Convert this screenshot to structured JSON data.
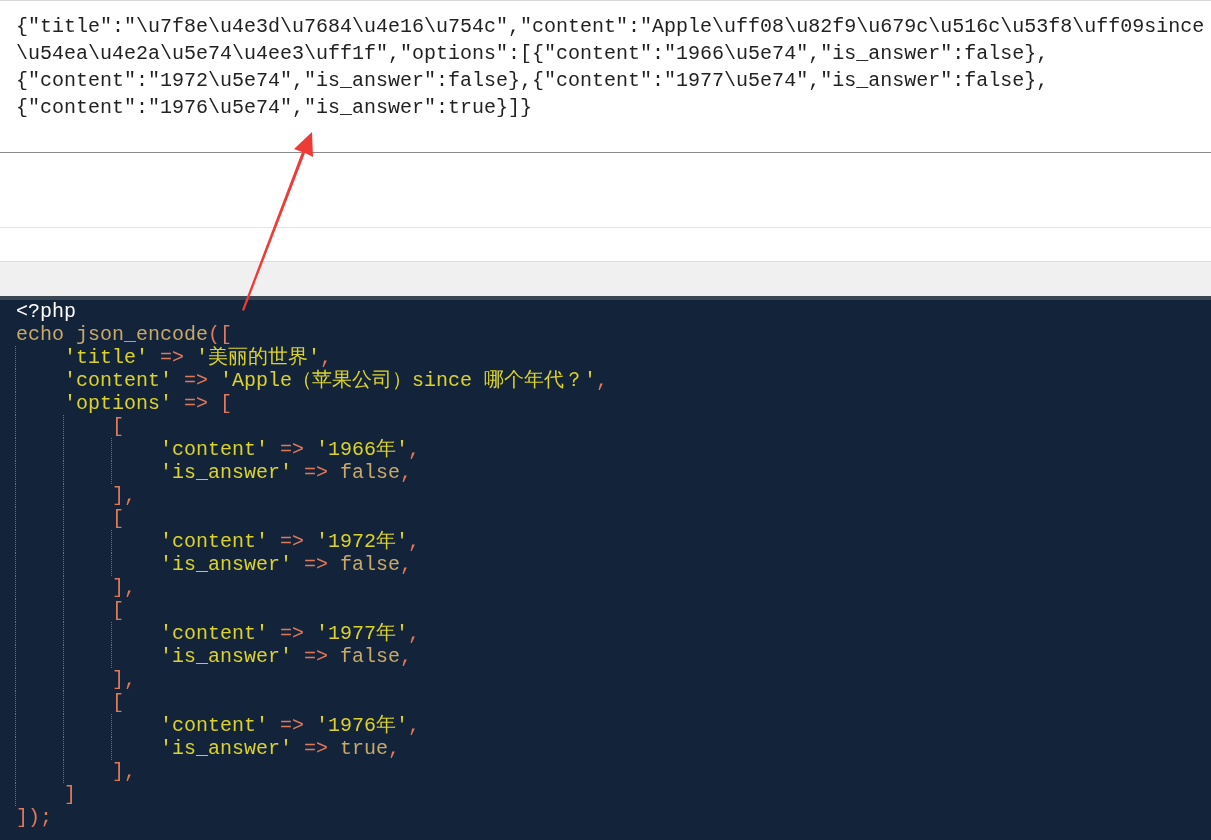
{
  "output_panel": {
    "lines": [
      "{\"title\":\"\\u7f8e\\u4e3d\\u7684\\u4e16\\u754c\",\"content\":\"Apple\\uff08\\u82f9\\u679c\\u516c\\u53f8\\uff09since",
      "\\u54ea\\u4e2a\\u5e74\\u4ee3\\uff1f\",\"options\":[{\"content\":\"1966\\u5e74\",\"is_answer\":false},",
      "{\"content\":\"1972\\u5e74\",\"is_answer\":false},{\"content\":\"1977\\u5e74\",\"is_answer\":false},",
      "{\"content\":\"1976\\u5e74\",\"is_answer\":true}]}"
    ]
  },
  "code_editor": {
    "lines": [
      {
        "tokens": [
          {
            "text": "<?php",
            "kind": "tag"
          }
        ]
      },
      {
        "tokens": [
          {
            "text": "echo json_encode",
            "kind": "keyword"
          },
          {
            "text": "([",
            "kind": "punct"
          }
        ],
        "children": [
          {
            "tokens": [
              {
                "text": "'title'",
                "kind": "string"
              },
              {
                "text": " => ",
                "kind": "punct"
              },
              {
                "text": "'美丽的世界'",
                "kind": "string"
              },
              {
                "text": ",",
                "kind": "punct"
              }
            ]
          },
          {
            "tokens": [
              {
                "text": "'content'",
                "kind": "string"
              },
              {
                "text": " => ",
                "kind": "punct"
              },
              {
                "text": "'Apple（苹果公司）since 哪个年代？'",
                "kind": "string"
              },
              {
                "text": ",",
                "kind": "punct"
              }
            ]
          },
          {
            "tokens": [
              {
                "text": "'options'",
                "kind": "string"
              },
              {
                "text": " => [",
                "kind": "punct"
              }
            ],
            "children": [
              {
                "tokens": [
                  {
                    "text": "[",
                    "kind": "punct"
                  }
                ],
                "children": [
                  {
                    "tokens": [
                      {
                        "text": "'content'",
                        "kind": "string"
                      },
                      {
                        "text": " => ",
                        "kind": "punct"
                      },
                      {
                        "text": "'1966年'",
                        "kind": "string"
                      },
                      {
                        "text": ",",
                        "kind": "punct"
                      }
                    ]
                  },
                  {
                    "tokens": [
                      {
                        "text": "'is_answer'",
                        "kind": "string"
                      },
                      {
                        "text": " => ",
                        "kind": "punct"
                      },
                      {
                        "text": "false",
                        "kind": "keyword"
                      },
                      {
                        "text": ",",
                        "kind": "punct"
                      }
                    ]
                  }
                ]
              },
              {
                "tokens": [
                  {
                    "text": "],",
                    "kind": "punct"
                  }
                ]
              },
              {
                "tokens": [
                  {
                    "text": "[",
                    "kind": "punct"
                  }
                ],
                "children": [
                  {
                    "tokens": [
                      {
                        "text": "'content'",
                        "kind": "string"
                      },
                      {
                        "text": " => ",
                        "kind": "punct"
                      },
                      {
                        "text": "'1972年'",
                        "kind": "string"
                      },
                      {
                        "text": ",",
                        "kind": "punct"
                      }
                    ]
                  },
                  {
                    "tokens": [
                      {
                        "text": "'is_answer'",
                        "kind": "string"
                      },
                      {
                        "text": " => ",
                        "kind": "punct"
                      },
                      {
                        "text": "false",
                        "kind": "keyword"
                      },
                      {
                        "text": ",",
                        "kind": "punct"
                      }
                    ]
                  }
                ]
              },
              {
                "tokens": [
                  {
                    "text": "],",
                    "kind": "punct"
                  }
                ]
              },
              {
                "tokens": [
                  {
                    "text": "[",
                    "kind": "punct"
                  }
                ],
                "children": [
                  {
                    "tokens": [
                      {
                        "text": "'content'",
                        "kind": "string"
                      },
                      {
                        "text": " => ",
                        "kind": "punct"
                      },
                      {
                        "text": "'1977年'",
                        "kind": "string"
                      },
                      {
                        "text": ",",
                        "kind": "punct"
                      }
                    ]
                  },
                  {
                    "tokens": [
                      {
                        "text": "'is_answer'",
                        "kind": "string"
                      },
                      {
                        "text": " => ",
                        "kind": "punct"
                      },
                      {
                        "text": "false",
                        "kind": "keyword"
                      },
                      {
                        "text": ",",
                        "kind": "punct"
                      }
                    ]
                  }
                ]
              },
              {
                "tokens": [
                  {
                    "text": "],",
                    "kind": "punct"
                  }
                ]
              },
              {
                "tokens": [
                  {
                    "text": "[",
                    "kind": "punct"
                  }
                ],
                "children": [
                  {
                    "tokens": [
                      {
                        "text": "'content'",
                        "kind": "string"
                      },
                      {
                        "text": " => ",
                        "kind": "punct"
                      },
                      {
                        "text": "'1976年'",
                        "kind": "string"
                      },
                      {
                        "text": ",",
                        "kind": "punct"
                      }
                    ]
                  },
                  {
                    "tokens": [
                      {
                        "text": "'is_answer'",
                        "kind": "string"
                      },
                      {
                        "text": " => ",
                        "kind": "punct"
                      },
                      {
                        "text": "true",
                        "kind": "keyword"
                      },
                      {
                        "text": ",",
                        "kind": "punct"
                      }
                    ]
                  }
                ]
              },
              {
                "tokens": [
                  {
                    "text": "],",
                    "kind": "punct"
                  }
                ]
              }
            ]
          },
          {
            "tokens": [
              {
                "text": "]",
                "kind": "punct"
              }
            ]
          }
        ]
      },
      {
        "tokens": [
          {
            "text": "]);",
            "kind": "punct"
          }
        ]
      }
    ]
  }
}
